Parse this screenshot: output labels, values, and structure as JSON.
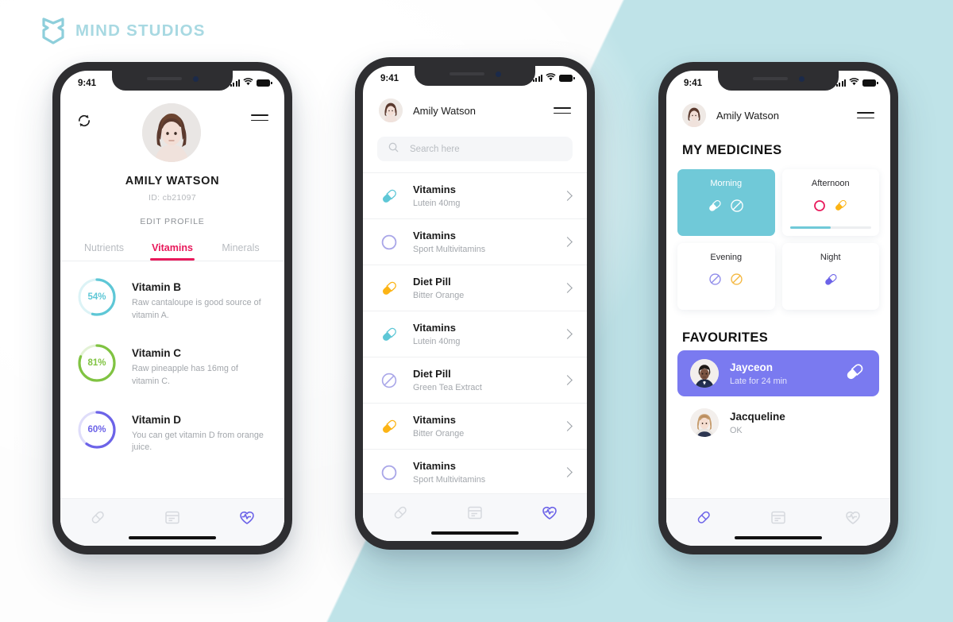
{
  "brand": {
    "name": "MIND STUDIOS",
    "logo_icon": "mind-studios-logo",
    "color": "#a8d9e2"
  },
  "background": {
    "accent_color": "#bfe3e8",
    "base_color": "#ffffff"
  },
  "status_bar": {
    "time": "9:41",
    "signal_icon": "cellular-bars-icon",
    "wifi_icon": "wifi-icon",
    "battery_icon": "battery-full-icon"
  },
  "nav": {
    "items": [
      {
        "icon": "pill-icon",
        "name": "medicines"
      },
      {
        "icon": "calendar-icon",
        "name": "schedule"
      },
      {
        "icon": "heart-pulse-icon",
        "name": "health"
      }
    ],
    "active_color": "#6c63e8",
    "inactive_color": "#d6d9de"
  },
  "screen_profile": {
    "sync_icon": "sync-refresh-icon",
    "menu_icon": "hamburger-menu-icon",
    "avatar": "user-avatar-amily",
    "name": "AMILY WATSON",
    "id": "ID: cb21097",
    "edit_label": "EDIT PROFILE",
    "tabs": [
      {
        "label": "Nutrients",
        "active": false
      },
      {
        "label": "Vitamins",
        "active": true
      },
      {
        "label": "Minerals",
        "active": false
      }
    ],
    "active_tab_color": "#e8195b",
    "vitamins": [
      {
        "percent": 54,
        "percent_label": "54%",
        "title": "Vitamin B",
        "desc": "Raw cantaloupe is good source of vitamin A.",
        "color": "#5ec7d6"
      },
      {
        "percent": 81,
        "percent_label": "81%",
        "title": "Vitamin C",
        "desc": "Raw pineapple has 16mg of vitamin C.",
        "color": "#80c342"
      },
      {
        "percent": 60,
        "percent_label": "60%",
        "title": "Vitamin D",
        "desc": "You can get vitamin D from orange juice.",
        "color": "#6c63e8"
      }
    ],
    "active_nav_index": 2
  },
  "screen_list": {
    "avatar": "user-avatar-amily",
    "user_name": "Amily Watson",
    "menu_icon": "hamburger-menu-icon",
    "search": {
      "icon": "search-icon",
      "placeholder": "Search here",
      "value": ""
    },
    "medicines": [
      {
        "title": "Vitamins",
        "subtitle": "Lutein 40mg",
        "icon": "capsule-icon",
        "color": "#5ec7d6"
      },
      {
        "title": "Vitamins",
        "subtitle": "Sport Multivitamins",
        "icon": "circle-pill-icon",
        "color": "#a9a6e8"
      },
      {
        "title": "Diet Pill",
        "subtitle": "Bitter Orange",
        "icon": "capsule-icon",
        "color": "#fcb415"
      },
      {
        "title": "Vitamins",
        "subtitle": "Lutein 40mg",
        "icon": "capsule-icon",
        "color": "#5ec7d6"
      },
      {
        "title": "Diet Pill",
        "subtitle": "Green Tea Extract",
        "icon": "tablet-icon",
        "color": "#a9a6e8"
      },
      {
        "title": "Vitamins",
        "subtitle": "Bitter Orange",
        "icon": "capsule-icon",
        "color": "#fcb415"
      },
      {
        "title": "Vitamins",
        "subtitle": "Sport Multivitamins",
        "icon": "circle-pill-icon",
        "color": "#a9a6e8"
      }
    ],
    "chevron_icon": "chevron-right-icon",
    "active_nav_index": 2
  },
  "screen_medicines": {
    "avatar": "user-avatar-amily",
    "user_name": "Amily Watson",
    "menu_icon": "hamburger-menu-icon",
    "section_medicines": "MY MEDICINES",
    "section_favourites": "FAVOURITES",
    "time_cards": [
      {
        "label": "Morning",
        "active": true,
        "progress": null,
        "icons": [
          {
            "icon": "capsule-icon",
            "color": "#ffffff"
          },
          {
            "icon": "tablet-icon",
            "color": "#ffffff"
          }
        ]
      },
      {
        "label": "Afternoon",
        "active": false,
        "progress": 50,
        "icons": [
          {
            "icon": "circle-pill-icon",
            "color": "#e8195b"
          },
          {
            "icon": "capsule-icon",
            "color": "#fcb415"
          }
        ]
      },
      {
        "label": "Evening",
        "active": false,
        "progress": null,
        "icons": [
          {
            "icon": "tablet-icon",
            "color": "#8f8bea"
          },
          {
            "icon": "tablet-icon",
            "color": "#f4b73f"
          }
        ]
      },
      {
        "label": "Night",
        "active": false,
        "progress": null,
        "icons": [
          {
            "icon": "capsule-icon",
            "color": "#6c63e8"
          }
        ]
      }
    ],
    "active_card_color": "#70c9d8",
    "favourites": [
      {
        "name": "Jayceon",
        "status": "Late for 24 min",
        "highlighted": true,
        "avatar": "contact-avatar-jayceon",
        "action_icon": "capsule-icon"
      },
      {
        "name": "Jacqueline",
        "status": "OK",
        "highlighted": false,
        "avatar": "contact-avatar-jacqueline",
        "action_icon": null
      }
    ],
    "highlight_color": "#7a7af0",
    "active_nav_index": 0
  }
}
